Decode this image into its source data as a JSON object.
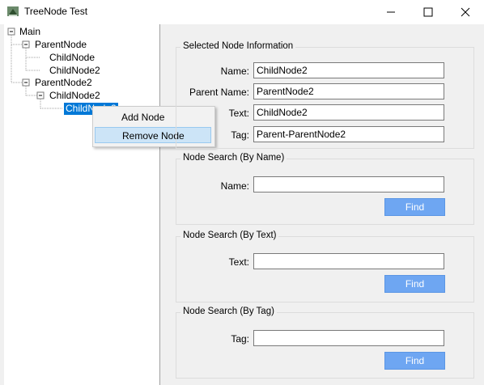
{
  "window": {
    "title": "TreeNode Test"
  },
  "tree": {
    "nodes": [
      {
        "label": "Main"
      },
      {
        "label": "ParentNode"
      },
      {
        "label": "ChildNode"
      },
      {
        "label": "ChildNode2"
      },
      {
        "label": "ParentNode2"
      },
      {
        "label": "ChildNode2"
      },
      {
        "label": "ChildNode2",
        "selected": true
      }
    ]
  },
  "context_menu": {
    "items": [
      {
        "label": "Add Node"
      },
      {
        "label": "Remove Node",
        "highlighted": true
      }
    ]
  },
  "selected_info": {
    "title": "Selected Node Information",
    "name_label": "Name:",
    "name_value": "ChildNode2",
    "parent_label": "Parent Name:",
    "parent_value": "ParentNode2",
    "text_label": "Text:",
    "text_value": "ChildNode2",
    "tag_label": "Tag:",
    "tag_value": "Parent-ParentNode2"
  },
  "search_name": {
    "title": "Node Search (By Name)",
    "label": "Name:",
    "value": "",
    "button": "Find"
  },
  "search_text": {
    "title": "Node Search (By Text)",
    "label": "Text:",
    "value": "",
    "button": "Find"
  },
  "search_tag": {
    "title": "Node Search (By Tag)",
    "label": "Tag:",
    "value": "",
    "button": "Find"
  },
  "colors": {
    "selection": "#0078d7",
    "button": "#6ea6f2",
    "menu_highlight": "#cce4f7"
  },
  "icons": [
    "app-tree-icon",
    "minimize-icon",
    "maximize-icon",
    "close-icon",
    "expand-collapse-icon"
  ]
}
